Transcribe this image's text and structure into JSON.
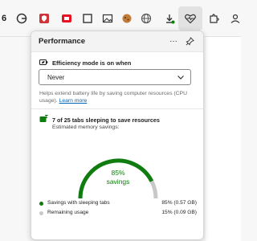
{
  "colors": {
    "accent_green": "#107c10",
    "remaining_gray": "#c8c8c8",
    "link_blue": "#0067b8"
  },
  "toolbar": {
    "icons": [
      "circle-g-icon",
      "shield-red-icon",
      "slides-red-icon",
      "square-icon",
      "image-icon",
      "cookie-icon",
      "globe-icon",
      "download-icon",
      "performance-heart-icon",
      "extensions-icon",
      "profile-icon"
    ],
    "left_glyph": "6"
  },
  "panel": {
    "title": "Performance",
    "more_label": "…",
    "efficiency": {
      "label": "Efficiency mode is on when",
      "selected": "Never",
      "help_text": "Helps extend battery life by saving computer resources (CPU usage).",
      "learn_more": "Learn more"
    },
    "sleeping": {
      "headline": "7 of 25 tabs sleeping to save resources",
      "estimated_label": "Estimated memory savings:",
      "percent": "85%",
      "percent_value": 85,
      "savings_word": "savings",
      "legend": [
        {
          "label": "Savings with sleeping tabs",
          "value": "85% (0.57 GB)",
          "color": "#107c10"
        },
        {
          "label": "Remaining usage",
          "value": "15% (0.09 GB)",
          "color": "#c8c8c8"
        }
      ]
    }
  }
}
